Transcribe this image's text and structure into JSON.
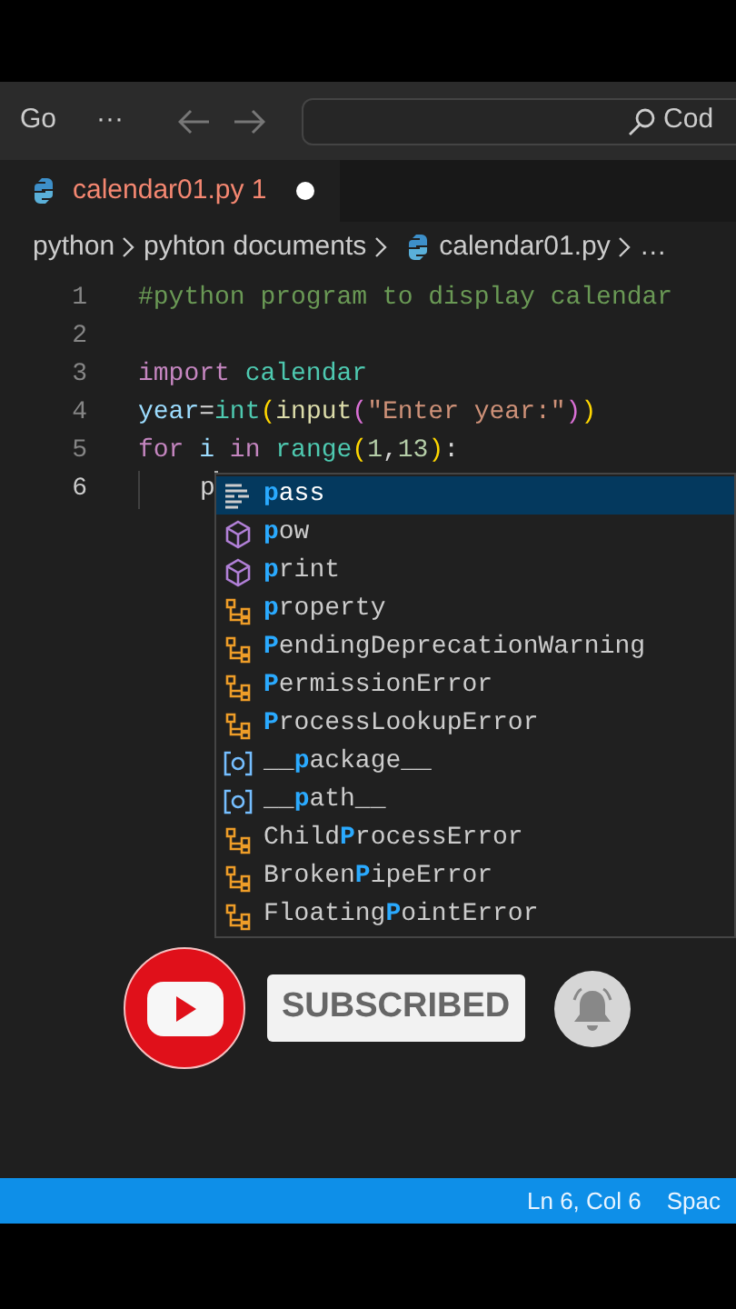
{
  "titlebar": {
    "menu": "Go",
    "more": "···",
    "search_text": "Cod"
  },
  "tabs": [
    {
      "label": "calendar01.py",
      "problems": "1",
      "modified": true,
      "selected": true
    }
  ],
  "breadcrumb": [
    {
      "text": "python",
      "kind": "folder"
    },
    {
      "text": "pyhton documents",
      "kind": "folder"
    },
    {
      "text": "calendar01.py",
      "kind": "file"
    },
    {
      "text": "…",
      "kind": "symbol"
    }
  ],
  "editor": {
    "lines": [
      {
        "number": "1",
        "cursor": false,
        "indented": false,
        "tokens": [
          {
            "text": "#python program to display calendar",
            "kind": "comment"
          }
        ]
      },
      {
        "number": "2",
        "cursor": false,
        "indented": false
      },
      {
        "number": "3",
        "cursor": false,
        "indented": false,
        "tokens": [
          {
            "text": "import ",
            "kind": "keyword"
          },
          {
            "text": "calendar",
            "kind": "module"
          }
        ]
      },
      {
        "number": "4",
        "cursor": false,
        "indented": false,
        "tokens": [
          {
            "text": "year",
            "kind": "variable"
          },
          {
            "text": "=",
            "kind": "plain"
          },
          {
            "text": "int",
            "kind": "class"
          },
          {
            "text": "(",
            "kind": "bracket1"
          },
          {
            "text": "input",
            "kind": "function"
          },
          {
            "text": "(",
            "kind": "bracket2"
          },
          {
            "text": "\"Enter year:\"",
            "kind": "string"
          },
          {
            "text": ")",
            "kind": "bracket2"
          },
          {
            "text": ")",
            "kind": "bracket1"
          }
        ]
      },
      {
        "number": "5",
        "cursor": false,
        "indented": false,
        "tokens": [
          {
            "text": "for ",
            "kind": "keyword"
          },
          {
            "text": "i ",
            "kind": "variable"
          },
          {
            "text": "in ",
            "kind": "keyword"
          },
          {
            "text": "range",
            "kind": "class"
          },
          {
            "text": "(",
            "kind": "bracket1"
          },
          {
            "text": "1",
            "kind": "number"
          },
          {
            "text": ",",
            "kind": "plain"
          },
          {
            "text": "13",
            "kind": "number"
          },
          {
            "text": ")",
            "kind": "bracket1"
          },
          {
            "text": ":",
            "kind": "plain"
          }
        ]
      },
      {
        "number": "6",
        "cursor": true,
        "indented": true,
        "tokens": [
          {
            "text": "p",
            "kind": "plain"
          }
        ]
      }
    ]
  },
  "suggestions": [
    {
      "kind": "keyword",
      "match": "p",
      "after": "ass",
      "selected": true
    },
    {
      "kind": "function",
      "match": "p",
      "after": "ow",
      "selected": false
    },
    {
      "kind": "function",
      "match": "p",
      "after": "rint",
      "selected": false
    },
    {
      "kind": "class",
      "match": "p",
      "after": "roperty",
      "selected": false
    },
    {
      "kind": "class",
      "match": "P",
      "after": "endingDeprecationWarning",
      "selected": false
    },
    {
      "kind": "class",
      "match": "P",
      "after": "ermissionError",
      "selected": false
    },
    {
      "kind": "class",
      "match": "P",
      "after": "rocessLookupError",
      "selected": false
    },
    {
      "kind": "variable",
      "before": "__",
      "match": "p",
      "after": "ackage__",
      "selected": false
    },
    {
      "kind": "variable",
      "before": "__",
      "match": "p",
      "after": "ath__",
      "selected": false
    },
    {
      "kind": "class",
      "before": "Child",
      "match": "P",
      "after": "rocessError",
      "selected": false
    },
    {
      "kind": "class",
      "before": "Broken",
      "match": "P",
      "after": "ipeError",
      "selected": false
    },
    {
      "kind": "class",
      "before": "Floating",
      "match": "P",
      "after": "ointError",
      "selected": false
    }
  ],
  "overlay": {
    "subscribe_label": "SUBSCRIBED"
  },
  "status_bar": {
    "position": "Ln 6, Col 6",
    "indent": "Spac"
  }
}
